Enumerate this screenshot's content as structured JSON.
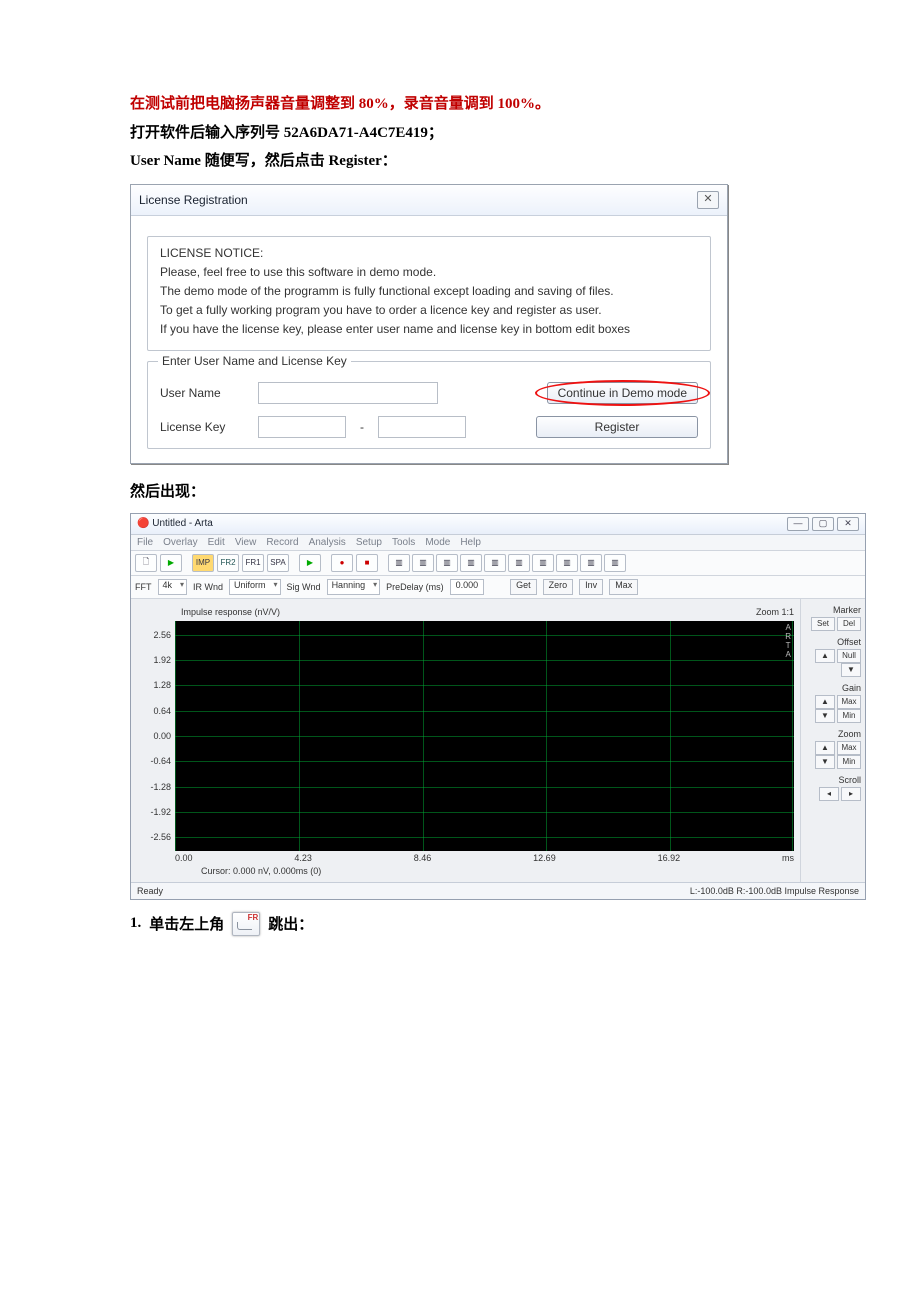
{
  "doc": {
    "line1_a": "在测试前把电脑扬声器音量调整到 ",
    "line1_b": "80%",
    "line1_c": "，录音音量调到 ",
    "line1_d": "100%",
    "line1_e": "。",
    "line2_a": "打开软件后输入序列号 ",
    "line2_serial": "52A6DA71-A4C7E419",
    "line2_b": "；",
    "line3": "User Name 随便写，然后点击 Register：",
    "after_dlg": "然后出现：",
    "step1_num": "1.",
    "step1_a": "单击左上角",
    "step1_b": "跳出："
  },
  "license_dialog": {
    "title": "License Registration",
    "close": "✕",
    "notice_heading": "LICENSE NOTICE:",
    "notice_l1": "Please, feel free to use this software in demo mode.",
    "notice_l2": "The demo mode of the programm is fully functional except loading and saving of files.",
    "notice_l3": "To get a fully working program you have to order a licence key and register as user.",
    "notice_l4": "If you have the license key, please enter user name and license key in bottom edit boxes",
    "group_legend": "Enter User Name and License Key",
    "user_name_lbl": "User Name",
    "license_key_lbl": "License Key",
    "license_key_sep": "-",
    "demo_btn": "Continue in Demo mode",
    "register_btn": "Register"
  },
  "arta": {
    "title": "Untitled - Arta",
    "menu": [
      "File",
      "Overlay",
      "Edit",
      "View",
      "Record",
      "Analysis",
      "Setup",
      "Tools",
      "Mode",
      "Help"
    ],
    "tb": {
      "new": "▫",
      "play": "▶",
      "imp": "IMP",
      "fr2": "FR2",
      "fr1": "FR1",
      "spa": "SPA",
      "go": "▶",
      "rec": "●",
      "stop": "■"
    },
    "tb2": {
      "fft": "FFT",
      "fft_val": "4k",
      "irwnd": "IR Wnd",
      "irwnd_val": "Uniform",
      "sigwnd": "Sig Wnd",
      "sigwnd_val": "Hanning",
      "predelay": "PreDelay (ms)",
      "predelay_val": "0.000",
      "get": "Get",
      "zero": "Zero",
      "inv": "Inv",
      "max": "Max"
    },
    "plot": {
      "title": "Impulse response (nV/V)",
      "zoom": "Zoom 1:1",
      "logo": "A\nR\nT\nA",
      "y": [
        "2.56",
        "1.92",
        "1.28",
        "0.64",
        "0.00",
        "-0.64",
        "-1.28",
        "-1.92",
        "-2.56"
      ],
      "x": [
        "0.00",
        "4.23",
        "8.46",
        "12.69",
        "16.92",
        "ms"
      ],
      "cursor": "Cursor: 0.000 nV, 0.000ms (0)"
    },
    "right": {
      "marker": "Marker",
      "set": "Set",
      "del": "Del",
      "offset": "Offset",
      "null": "Null",
      "gain": "Gain",
      "max": "Max",
      "min": "Min",
      "zoom": "Zoom",
      "scroll": "Scroll"
    },
    "status": {
      "ready": "Ready",
      "right": "L:-100.0dB   R:-100.0dB   Impulse Response"
    }
  }
}
